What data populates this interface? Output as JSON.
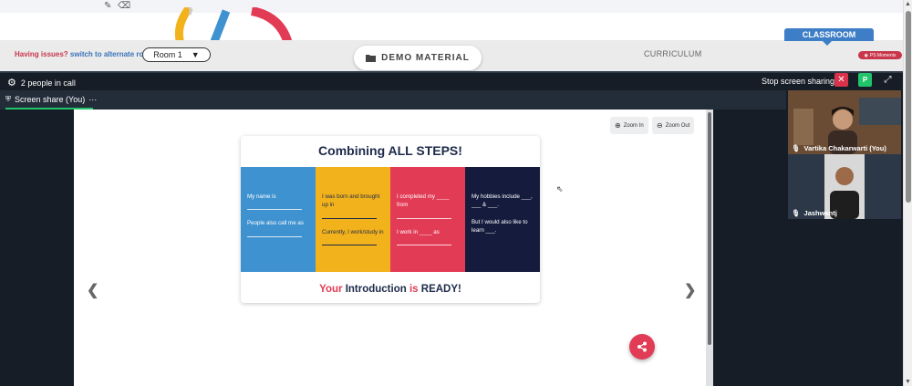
{
  "colors": {
    "accent_red": "#e23b55",
    "accent_green": "#21c46b",
    "classroom_blue": "#3d7ec7",
    "call_bg": "#161d26"
  },
  "toolbar_icons": [
    "pencil-icon",
    "eraser-icon"
  ],
  "top_bar": {
    "issue_text": "Having issues?",
    "alt_room_link": "switch to alternate room",
    "room_select": {
      "value": "Room 1"
    },
    "demo_material": "DEMO MATERIAL",
    "curriculum": "CURRICULUM",
    "classroom": "CLASSROOM",
    "moments_badge": "PS Moments"
  },
  "call": {
    "people_count": "2 people in call",
    "stop_sharing": "Stop screen sharing",
    "close_label": "✕",
    "p_label": "P",
    "screen_share_tab": "Screen share (You)",
    "more_label": "···",
    "zoom_in": "Zoom In",
    "zoom_out": "Zoom Out"
  },
  "slide": {
    "title": "Combining ALL STEPS!",
    "columns": [
      {
        "color": "#3f92d0",
        "line1": "My name is",
        "line2": "People also call me as"
      },
      {
        "color": "#f2b21c",
        "line1": "I was born and brought up in",
        "line2": "Currently, I work/study in"
      },
      {
        "color": "#e23b55",
        "line1": "I completed my ____ from",
        "line2": "I work in ____ as"
      },
      {
        "color": "#151b3d",
        "line1": "My hobbies include ___, ___ & ___.",
        "line2": "But I would also like to learn ___."
      }
    ],
    "footer_your": "Your",
    "footer_intro": "Introduction",
    "footer_is": "is",
    "footer_ready": "READY!"
  },
  "participants": [
    {
      "name": "Vartika Chakarwarti (You)"
    },
    {
      "name": "Jashwantj"
    }
  ]
}
